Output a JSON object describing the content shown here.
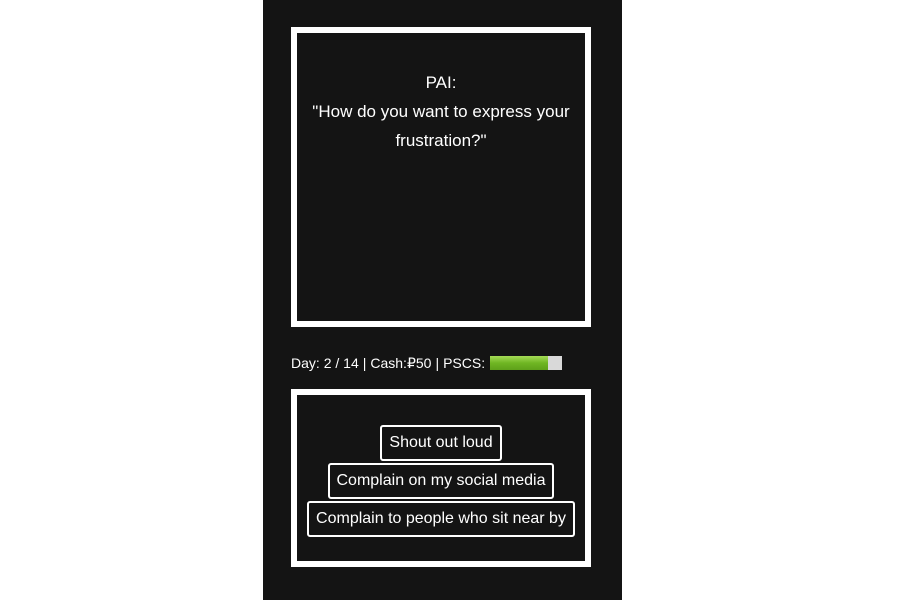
{
  "dialog": {
    "speaker": "PAI:",
    "text": "\"How do you want to express your frustration?\""
  },
  "status": {
    "day_label": "Day:",
    "day_current": "2",
    "day_total": "14",
    "cash_label": "Cash:",
    "cash_value": "₽50",
    "pscs_label": "PSCS:",
    "pscs_level": 0.8,
    "colors": {
      "meter_fill": "#6fb623",
      "meter_track": "#d9d9d9"
    }
  },
  "choices": [
    {
      "label": "Shout out loud"
    },
    {
      "label": "Complain on my social media"
    },
    {
      "label": "Complain to people who sit near by"
    }
  ],
  "theme": {
    "background": "#141414",
    "border": "#ffffff",
    "text": "#ffffff"
  }
}
